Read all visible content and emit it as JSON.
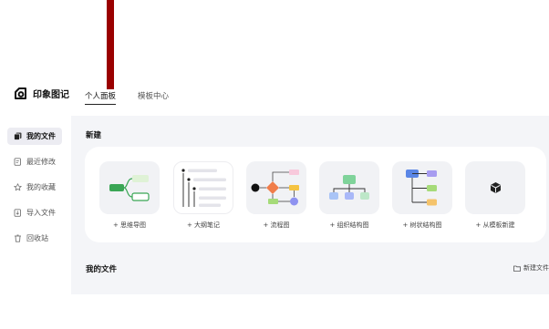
{
  "app": {
    "name": "印象图记"
  },
  "nav": {
    "tabs": [
      {
        "label": "个人面板"
      },
      {
        "label": "模板中心"
      }
    ]
  },
  "sidebar": {
    "items": [
      {
        "label": "我的文件",
        "icon": "file-icon",
        "active": true
      },
      {
        "label": "最近修改",
        "icon": "recent-edit-icon",
        "active": false
      },
      {
        "label": "我的收藏",
        "icon": "star-icon",
        "active": false
      },
      {
        "label": "导入文件",
        "icon": "import-icon",
        "active": false
      },
      {
        "label": "回收站",
        "icon": "trash-icon",
        "active": false
      }
    ]
  },
  "main": {
    "new_section_title": "新建",
    "create_cards": [
      {
        "label": "+ 思维导图",
        "icon": "mindmap-icon"
      },
      {
        "label": "+ 大纲笔记",
        "icon": "outline-icon"
      },
      {
        "label": "+ 流程图",
        "icon": "flowchart-icon"
      },
      {
        "label": "+ 组织结构图",
        "icon": "org-chart-icon"
      },
      {
        "label": "+ 树状结构图",
        "icon": "tree-chart-icon"
      },
      {
        "label": "+ 从模板新建",
        "icon": "cube-icon"
      }
    ],
    "files_section_title": "我的文件",
    "new_file_label": "新建文件"
  },
  "colors": {
    "accent_bar": "#9a0000",
    "sidebar_active_bg": "#ececf2",
    "main_bg": "#f4f5f8",
    "mindmap_green": "#3aa655",
    "flow_orange": "#f07d4a",
    "flow_yellow": "#f5c342",
    "flow_purple": "#8e92f0",
    "org_green": "#7fd39a",
    "org_blue": "#a9c4f6",
    "tree_blue": "#5a86e6",
    "tree_purple": "#a79cf0",
    "tree_green": "#a6db79",
    "tree_orange": "#f5c36b"
  }
}
